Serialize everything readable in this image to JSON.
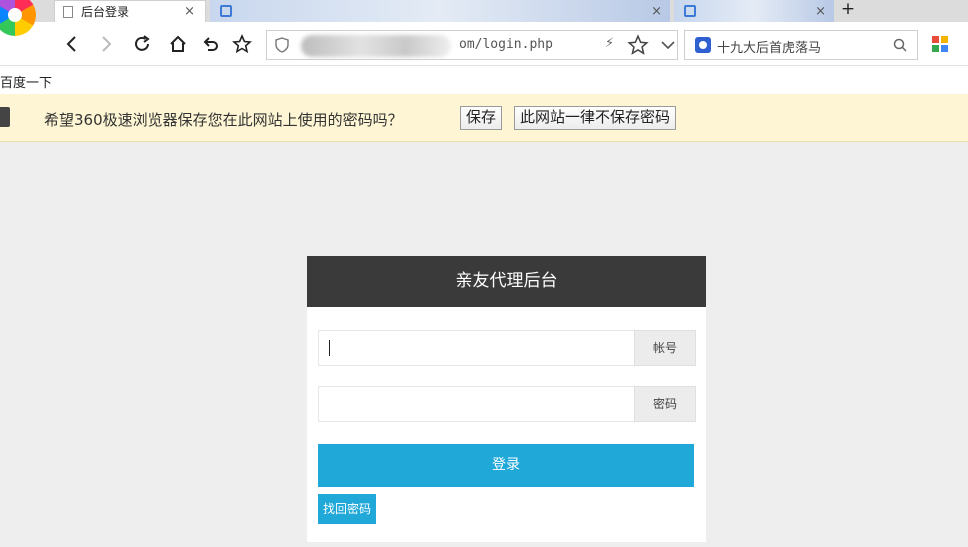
{
  "browser": {
    "tabs": [
      {
        "label": "后台登录",
        "active": true
      },
      {
        "label": "",
        "active": false
      },
      {
        "label": "",
        "active": false
      }
    ],
    "new_tab_label": "+",
    "address": {
      "url_visible": "om/login.php"
    },
    "search": {
      "text": "十九大后首虎落马"
    },
    "bookmarks": [
      "百度一下"
    ]
  },
  "password_bar": {
    "message": "希望360极速浏览器保存您在此网站上使用的密码吗？",
    "save_label": "保存",
    "never_label": "此网站一律不保存密码"
  },
  "login": {
    "title": "亲友代理后台",
    "account_label": "帐号",
    "password_label": "密码",
    "submit_label": "登录",
    "forgot_label": "找回密码"
  },
  "colors": {
    "header_bg": "#3a3a3a",
    "accent": "#1fa8d8",
    "page_bg": "#eeeeee",
    "save_bar_bg": "#fdf5d3"
  }
}
